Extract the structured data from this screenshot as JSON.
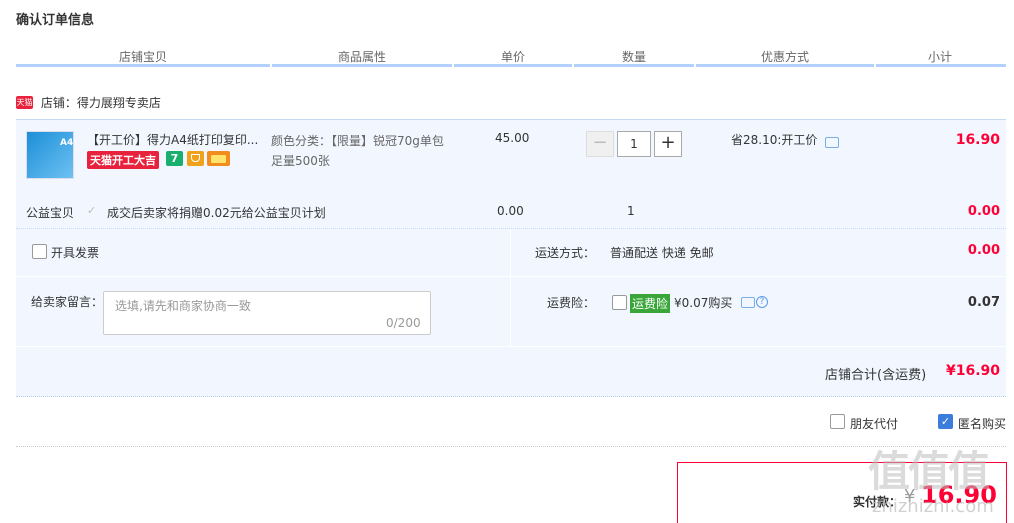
{
  "page": {
    "title": "确认订单信息"
  },
  "columns": [
    "店铺宝贝",
    "商品属性",
    "单价",
    "数量",
    "优惠方式",
    "小计"
  ],
  "shop": {
    "badge": "天猫",
    "label": "店铺：得力展翔专卖店"
  },
  "item": {
    "name": "【开工价】得力A4纸打印复印...",
    "thumb_text": "A4",
    "promo_tag": "天猫开工大吉",
    "attr_line1": "颜色分类：【限量】锐冠70g单包",
    "attr_line2": "足量500张",
    "price": "45.00",
    "quantity": "1",
    "minus": "−",
    "plus": "+",
    "discount": "省28.10:开工价",
    "subtotal": "16.90",
    "icon_colors": {
      "seven_day": "#1aae6f",
      "guarantee": "#f0a21b",
      "card": "#f28c1c"
    }
  },
  "charity": {
    "label": "公益宝贝",
    "check": "✓",
    "text": "成交后卖家将捐赠0.02元给公益宝贝计划",
    "price": "0.00",
    "quantity": "1",
    "total": "0.00"
  },
  "invoice": {
    "label": "开具发票"
  },
  "shipping": {
    "label": "运送方式：",
    "value": "普通配送 快递 免邮",
    "total": "0.00"
  },
  "memo": {
    "label": "给卖家留言：",
    "placeholder": "选填,请先和商家协商一致",
    "count": "0/200"
  },
  "insurance": {
    "label": "运费险：",
    "tag": "运费险",
    "price": "¥0.07购买",
    "help": "?",
    "total": "0.07"
  },
  "shop_total": {
    "label": "店铺合计(含运费)",
    "value": "¥16.90"
  },
  "options": {
    "friend_pay": "朋友代付",
    "anonymous": "匿名购买",
    "anon_check": "✓"
  },
  "payment": {
    "label": "实付款：",
    "yen": "¥",
    "amount": "16.90"
  },
  "watermark": {
    "main": "值值值",
    "sub": "zhizhizhi.com"
  },
  "colors": {
    "accent_red": "#ff0036",
    "header_line": "#b2d1ff",
    "row_bg": "#f2f7ff",
    "check_blue": "#3b7ddd"
  }
}
